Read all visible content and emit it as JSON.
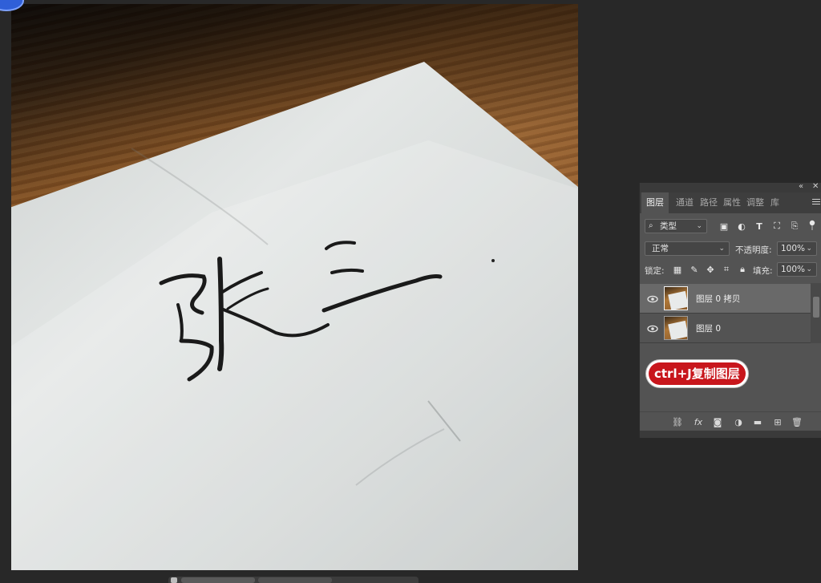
{
  "canvas": {
    "handwriting": "张三"
  },
  "panel": {
    "collapse_icon": "double-chevron-left",
    "close_icon": "close",
    "tabs": [
      {
        "label": "图层",
        "active": true
      },
      {
        "label": "通道",
        "active": false
      },
      {
        "label": "路径",
        "active": false
      },
      {
        "label": "属性",
        "active": false
      },
      {
        "label": "调整",
        "active": false
      },
      {
        "label": "库",
        "active": false
      }
    ],
    "filter": {
      "value": "类型"
    },
    "blend_mode": {
      "value": "正常"
    },
    "opacity": {
      "label": "不透明度:",
      "value": "100%"
    },
    "lock": {
      "label": "锁定:"
    },
    "fill": {
      "label": "填充:",
      "value": "100%"
    },
    "layers": [
      {
        "name": "图层 0 拷贝",
        "selected": true,
        "visible": true
      },
      {
        "name": "图层 0",
        "selected": false,
        "visible": true
      }
    ],
    "annotation": "ctrl+J复制图层"
  },
  "colors": {
    "workspace_bg": "#282828",
    "panel_bg": "#535353",
    "selected_layer": "#696969",
    "annotation_red": "#c8161c"
  }
}
